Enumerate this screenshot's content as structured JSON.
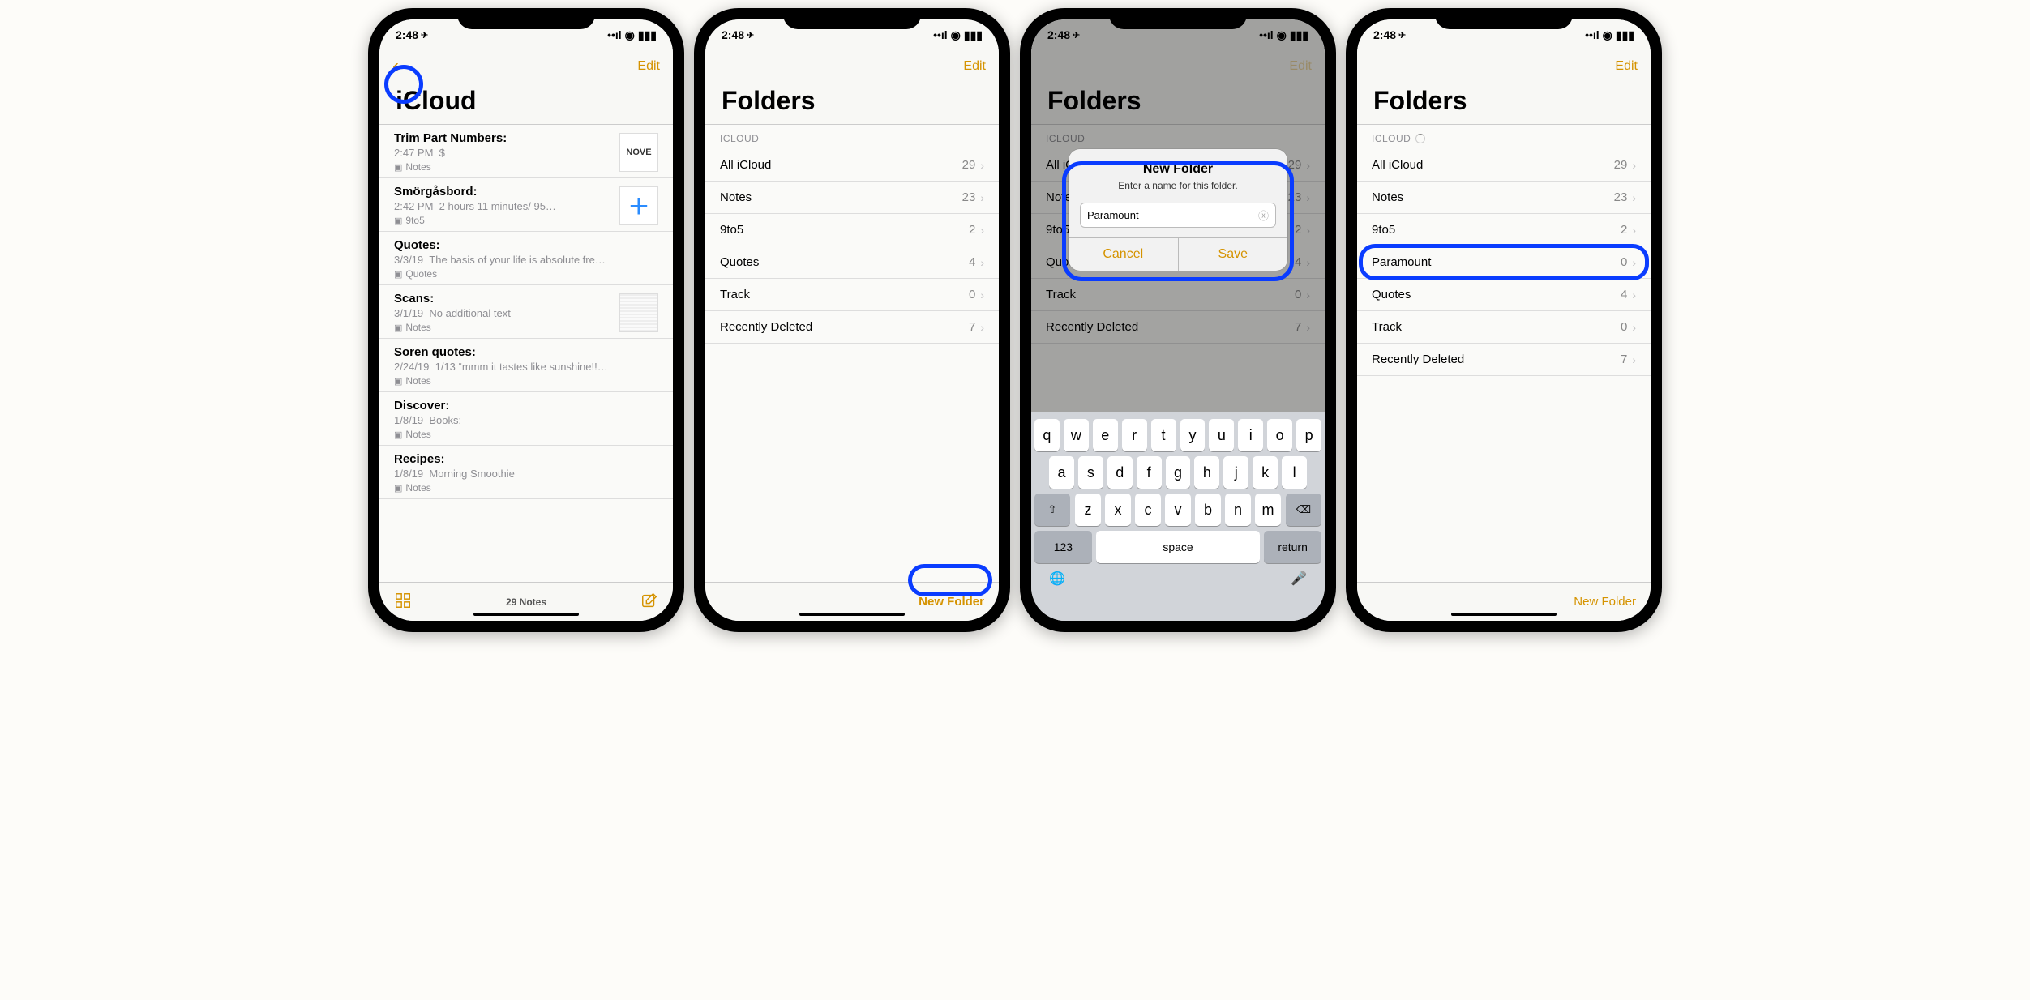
{
  "status": {
    "time": "2:48",
    "location_glyph": "➤"
  },
  "accent": "#d59300",
  "annot_color": "#0a3cff",
  "phone1": {
    "nav": {
      "edit": "Edit"
    },
    "title": "iCloud",
    "notes": [
      {
        "title": "Trim Part Numbers:",
        "sub_left": "2:47 PM",
        "sub_right": "$",
        "folder": "Notes",
        "thumb_text": "NOVE"
      },
      {
        "title": "Smörgåsbord:",
        "sub_left": "2:42 PM",
        "sub_right": "2 hours 11 minutes/ 95…",
        "folder": "9to5",
        "thumb_text": "+"
      },
      {
        "title": "Quotes:",
        "sub_left": "3/3/19",
        "sub_right": "The basis of your life is absolute fre…",
        "folder": "Quotes"
      },
      {
        "title": "Scans:",
        "sub_left": "3/1/19",
        "sub_right": "No additional text",
        "folder": "Notes",
        "thumb_text": "scan"
      },
      {
        "title": "Soren quotes:",
        "sub_left": "2/24/19",
        "sub_right": "1/13 “mmm it tastes like sunshine!!…",
        "folder": "Notes"
      },
      {
        "title": "Discover:",
        "sub_left": "1/8/19",
        "sub_right": "Books:",
        "folder": "Notes"
      },
      {
        "title": "Recipes:",
        "sub_left": "1/8/19",
        "sub_right": "Morning Smoothie",
        "folder": "Notes"
      }
    ],
    "toolbar": {
      "count": "29 Notes"
    }
  },
  "phone2": {
    "nav": {
      "edit": "Edit"
    },
    "title": "Folders",
    "section": "ICLOUD",
    "folders": [
      {
        "name": "All iCloud",
        "count": 29
      },
      {
        "name": "Notes",
        "count": 23
      },
      {
        "name": "9to5",
        "count": 2
      },
      {
        "name": "Quotes",
        "count": 4
      },
      {
        "name": "Track",
        "count": 0
      },
      {
        "name": "Recently Deleted",
        "count": 7
      }
    ],
    "toolbar": {
      "new_folder": "New Folder"
    }
  },
  "phone3": {
    "nav": {
      "edit": "Edit"
    },
    "title": "Folders",
    "section": "ICLOUD",
    "alert": {
      "title": "New Folder",
      "message": "Enter a name for this folder.",
      "input_value": "Paramount",
      "cancel": "Cancel",
      "save": "Save"
    },
    "folders_dim": [
      {
        "name": "All iCloud",
        "count": 29
      },
      {
        "name": "Notes",
        "count": 23
      },
      {
        "name": "9to5",
        "count": 2
      },
      {
        "name": "Quotes",
        "count": 4
      },
      {
        "name": "Track",
        "count": 0
      },
      {
        "name": "Recently Deleted",
        "count": 7
      }
    ],
    "keyboard": {
      "row1": [
        "q",
        "w",
        "e",
        "r",
        "t",
        "y",
        "u",
        "i",
        "o",
        "p"
      ],
      "row2": [
        "a",
        "s",
        "d",
        "f",
        "g",
        "h",
        "j",
        "k",
        "l"
      ],
      "row3": [
        "z",
        "x",
        "c",
        "v",
        "b",
        "n",
        "m"
      ],
      "num": "123",
      "space": "space",
      "return": "return"
    }
  },
  "phone4": {
    "nav": {
      "edit": "Edit"
    },
    "title": "Folders",
    "section": "ICLOUD",
    "folders": [
      {
        "name": "All iCloud",
        "count": 29
      },
      {
        "name": "Notes",
        "count": 23
      },
      {
        "name": "9to5",
        "count": 2
      },
      {
        "name": "Paramount",
        "count": 0,
        "highlight": true
      },
      {
        "name": "Quotes",
        "count": 4
      },
      {
        "name": "Track",
        "count": 0
      },
      {
        "name": "Recently Deleted",
        "count": 7
      }
    ],
    "toolbar": {
      "new_folder": "New Folder"
    }
  }
}
